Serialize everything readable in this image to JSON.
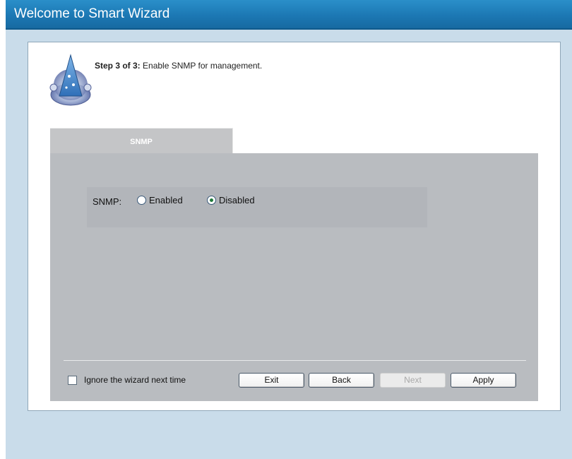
{
  "header": {
    "title": "Welcome to Smart Wizard"
  },
  "step": {
    "prefix": "Step 3 of 3:",
    "description": " Enable SNMP for management."
  },
  "tabs": [
    {
      "label": "SNMP",
      "active": true
    }
  ],
  "snmp": {
    "label": "SNMP:",
    "options": [
      {
        "label": "Enabled",
        "checked": false
      },
      {
        "label": "Disabled",
        "checked": true
      }
    ]
  },
  "footer": {
    "ignore_label": "Ignore the wizard next time",
    "ignore_checked": false,
    "buttons": [
      {
        "label": "Exit",
        "enabled": true
      },
      {
        "label": "Back",
        "enabled": true
      },
      {
        "label": "Next",
        "enabled": false
      },
      {
        "label": "Apply",
        "enabled": true
      }
    ]
  },
  "colors": {
    "title_bar": "#1c78b4",
    "page_background": "#c9dcea",
    "panel": "#b9bcc0"
  }
}
